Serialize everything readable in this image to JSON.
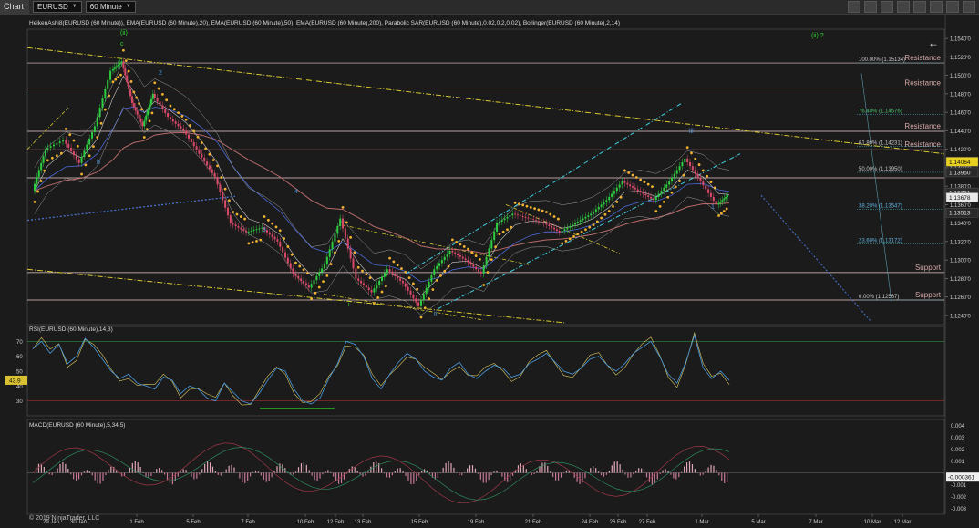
{
  "toolbar": {
    "title": "Chart",
    "instrument": "EURUSD",
    "period": "60 Minute"
  },
  "main_label": "HeikenAshi8(EURUSD (60 Minute)), EMA(EURUSD (60 Minute),20), EMA(EURUSD (60 Minute),50), EMA(EURUSD (60 Minute),200), Parabolic SAR(EURUSD (60 Minute),0.02,0.2,0.02), Bollinger(EURUSD (60 Minute),2,14)",
  "rsi_label": "RSI(EURUSD (60 Minute),14,3)",
  "macd_label": "MACD(EURUSD (60 Minute),5,34,5)",
  "copyright": "© 2019 NinjaTrader, LLC",
  "wave_top_label": "(ii) ?",
  "colors": {
    "background": "#1b1b1b",
    "candle_up": "#2ecc40",
    "candle_down": "#d94a6a",
    "sar": "#f0b030",
    "trendline_yellow": "#d8c830",
    "channel_cyan": "#3fd0e0",
    "dotted_blue": "#4a78d8",
    "level_line": "#e8c8c8"
  },
  "chart_data": [
    {
      "type": "line",
      "name": "price",
      "y_axis_ticks": [
        "1.1540'0",
        "1.1520'0",
        "1.1500'0",
        "1.1480'0",
        "1.1460'0",
        "1.1440'0",
        "1.1420'0",
        "1.1400'0",
        "1.1380'0",
        "1.1360'0",
        "1.1340'0",
        "1.1320'0",
        "1.1300'0",
        "1.1280'0",
        "1.1260'0",
        "1.1240'0"
      ],
      "x_axis_ticks": [
        "29 Jan",
        "30 Jan",
        "1 Feb",
        "5 Feb",
        "7 Feb",
        "10 Feb",
        "12 Feb",
        "13 Feb",
        "15 Feb",
        "19 Feb",
        "21 Feb",
        "24 Feb",
        "26 Feb",
        "27 Feb",
        "1 Mar",
        "5 Mar",
        "7 Mar",
        "10 Mar",
        "12 Mar"
      ],
      "ylim": [
        1.123,
        1.155
      ],
      "price_markers": [
        {
          "label": "1.14064",
          "value": 1.14064,
          "style": "yellow"
        },
        {
          "label": "1.13950",
          "value": 1.1395,
          "style": "dark"
        },
        {
          "label": "1.13731",
          "value": 1.13731,
          "style": "dark"
        },
        {
          "label": "1.13678",
          "value": 1.13678,
          "style": "white"
        },
        {
          "label": "1.13513",
          "value": 1.13513,
          "style": "dark"
        }
      ],
      "fib_levels": [
        {
          "label": "100.00% (1.15134)",
          "value": 1.15134
        },
        {
          "label": "76.40% (1.14576)",
          "value": 1.14576
        },
        {
          "label": "61.80% (1.14231)",
          "value": 1.14231
        },
        {
          "label": "50.00% (1.13950)",
          "value": 1.1395
        },
        {
          "label": "38.20% (1.13547)",
          "value": 1.13547
        },
        {
          "label": "23.60% (1.13172)",
          "value": 1.13172
        },
        {
          "label": "0.00% (1.12567)",
          "value": 1.12567
        }
      ],
      "sr_lines": [
        {
          "label": "Resistance",
          "value": 1.15134
        },
        {
          "label": "Resistance",
          "value": 1.14864
        },
        {
          "label": "Resistance",
          "value": 1.14394
        },
        {
          "label": "Resistance",
          "value": 1.14194
        },
        {
          "label": "",
          "value": 1.1389
        },
        {
          "label": "Support",
          "value": 1.12864
        },
        {
          "label": "Support",
          "value": 1.12567
        }
      ],
      "wave_labels": [
        "(ii)",
        "c",
        "2",
        "b",
        "3",
        "4",
        "i",
        "ii",
        "iii",
        "1"
      ],
      "series": [
        {
          "x": 0,
          "y": 1.1375
        },
        {
          "x": 5,
          "y": 1.142
        },
        {
          "x": 12,
          "y": 1.143
        },
        {
          "x": 18,
          "y": 1.1405
        },
        {
          "x": 24,
          "y": 1.1445
        },
        {
          "x": 30,
          "y": 1.1505
        },
        {
          "x": 34,
          "y": 1.1515
        },
        {
          "x": 38,
          "y": 1.147
        },
        {
          "x": 42,
          "y": 1.1445
        },
        {
          "x": 46,
          "y": 1.148
        },
        {
          "x": 52,
          "y": 1.1455
        },
        {
          "x": 58,
          "y": 1.144
        },
        {
          "x": 64,
          "y": 1.1415
        },
        {
          "x": 70,
          "y": 1.139
        },
        {
          "x": 76,
          "y": 1.134
        },
        {
          "x": 82,
          "y": 1.133
        },
        {
          "x": 88,
          "y": 1.1335
        },
        {
          "x": 94,
          "y": 1.132
        },
        {
          "x": 100,
          "y": 1.1285
        },
        {
          "x": 106,
          "y": 1.127
        },
        {
          "x": 112,
          "y": 1.1295
        },
        {
          "x": 118,
          "y": 1.1345
        },
        {
          "x": 124,
          "y": 1.128
        },
        {
          "x": 130,
          "y": 1.1265
        },
        {
          "x": 136,
          "y": 1.129
        },
        {
          "x": 142,
          "y": 1.1275
        },
        {
          "x": 148,
          "y": 1.125
        },
        {
          "x": 154,
          "y": 1.129
        },
        {
          "x": 160,
          "y": 1.131
        },
        {
          "x": 166,
          "y": 1.13
        },
        {
          "x": 172,
          "y": 1.1285
        },
        {
          "x": 178,
          "y": 1.134
        },
        {
          "x": 184,
          "y": 1.135
        },
        {
          "x": 190,
          "y": 1.1345
        },
        {
          "x": 196,
          "y": 1.134
        },
        {
          "x": 202,
          "y": 1.133
        },
        {
          "x": 208,
          "y": 1.134
        },
        {
          "x": 214,
          "y": 1.135
        },
        {
          "x": 220,
          "y": 1.1365
        },
        {
          "x": 226,
          "y": 1.1385
        },
        {
          "x": 232,
          "y": 1.1375
        },
        {
          "x": 238,
          "y": 1.1365
        },
        {
          "x": 244,
          "y": 1.1385
        },
        {
          "x": 250,
          "y": 1.141
        },
        {
          "x": 256,
          "y": 1.1385
        },
        {
          "x": 262,
          "y": 1.136
        },
        {
          "x": 266,
          "y": 1.137
        }
      ]
    },
    {
      "type": "line",
      "name": "RSI",
      "y_axis_ticks": [
        "70",
        "60",
        "50",
        "40",
        "30"
      ],
      "current_label": "43.9",
      "ylim": [
        20,
        80
      ],
      "values": [
        65,
        70,
        62,
        68,
        55,
        60,
        72,
        66,
        58,
        50,
        45,
        48,
        42,
        40,
        38,
        46,
        44,
        35,
        40,
        38,
        32,
        30,
        42,
        36,
        30,
        28,
        35,
        44,
        52,
        50,
        38,
        30,
        28,
        32,
        45,
        55,
        70,
        68,
        60,
        45,
        38,
        48,
        56,
        62,
        58,
        50,
        46,
        44,
        52,
        56,
        48,
        45,
        50,
        54,
        52,
        46,
        48,
        55,
        58,
        62,
        56,
        50,
        48,
        52,
        58,
        60,
        54,
        50,
        55,
        62,
        66,
        70,
        60,
        48,
        42,
        56,
        74,
        52,
        45,
        50,
        44
      ]
    },
    {
      "type": "bar",
      "name": "MACD",
      "y_axis_ticks": [
        "0.004",
        "0.003",
        "0.002",
        "0.001",
        "-0.001",
        "-0.002",
        "-0.003"
      ],
      "current_label": "-0.000361",
      "ylim": [
        -0.0035,
        0.0045
      ]
    }
  ]
}
